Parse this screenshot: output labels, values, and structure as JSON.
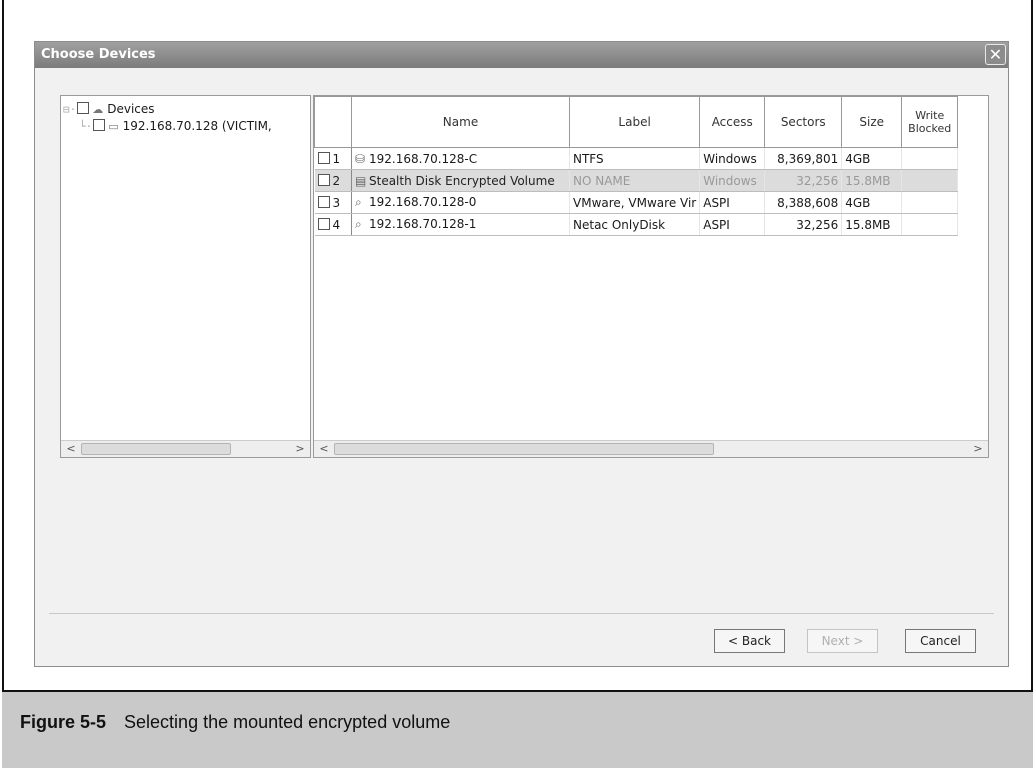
{
  "dialog": {
    "title": "Choose Devices",
    "close_glyph": "✕"
  },
  "tree": {
    "root_label": "Devices",
    "child_label": "192.168.70.128 (VICTIM,"
  },
  "grid": {
    "columns": [
      "Name",
      "Label",
      "Access",
      "Sectors",
      "Size",
      "Write Blocked"
    ],
    "rows": [
      {
        "index": "1",
        "icon": "drive-icon",
        "name": "192.168.70.128-C",
        "label": "NTFS",
        "access": "Windows",
        "sectors": "8,369,801",
        "size": "4GB",
        "write_blocked": ""
      },
      {
        "index": "2",
        "icon": "volume-icon",
        "name": "Stealth Disk Encrypted Volume",
        "label": "NO NAME",
        "access": "Windows",
        "sectors": "32,256",
        "size": "15.8MB",
        "write_blocked": ""
      },
      {
        "index": "3",
        "icon": "disk-search-icon",
        "name": "192.168.70.128-0",
        "label": "VMware, VMware Vir",
        "access": "ASPI",
        "sectors": "8,388,608",
        "size": "4GB",
        "write_blocked": ""
      },
      {
        "index": "4",
        "icon": "disk-search-icon",
        "name": "192.168.70.128-1",
        "label": "Netac OnlyDisk",
        "access": "ASPI",
        "sectors": "32,256",
        "size": "15.8MB",
        "write_blocked": ""
      }
    ]
  },
  "buttons": {
    "back": "< Back",
    "next": "Next >",
    "cancel": "Cancel"
  },
  "figure": {
    "number": "Figure 5-5",
    "caption": "Selecting the mounted encrypted volume"
  },
  "scroll": {
    "left_arrow": "<",
    "right_arrow": ">"
  }
}
